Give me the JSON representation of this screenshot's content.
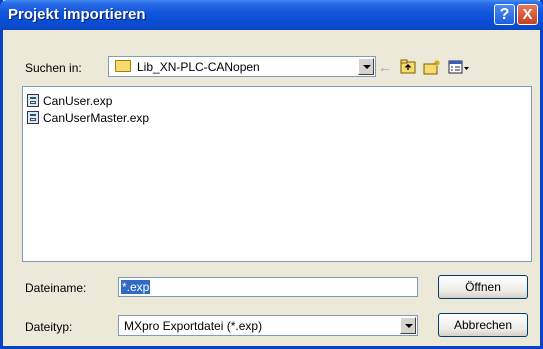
{
  "window": {
    "title": "Projekt importieren"
  },
  "titlebar": {
    "help_label": "?",
    "close_label": "X"
  },
  "lookin": {
    "label": "Suchen in:",
    "value": "Lib_XN-PLC-CANopen"
  },
  "toolbar": {
    "back_icon": "back-arrow-icon",
    "up_icon": "up-folder-icon",
    "newfolder_icon": "new-folder-icon",
    "view_icon": "view-menu-icon"
  },
  "files": [
    {
      "name": "CanUser.exp",
      "icon": "exp-file-icon"
    },
    {
      "name": "CanUserMaster.exp",
      "icon": "exp-file-icon"
    }
  ],
  "filename": {
    "label": "Dateiname:",
    "value": "*.exp"
  },
  "filetype": {
    "label": "Dateityp:",
    "value": "MXpro Exportdatei (*.exp)"
  },
  "buttons": {
    "open": "Öffnen",
    "cancel": "Abbrechen"
  }
}
